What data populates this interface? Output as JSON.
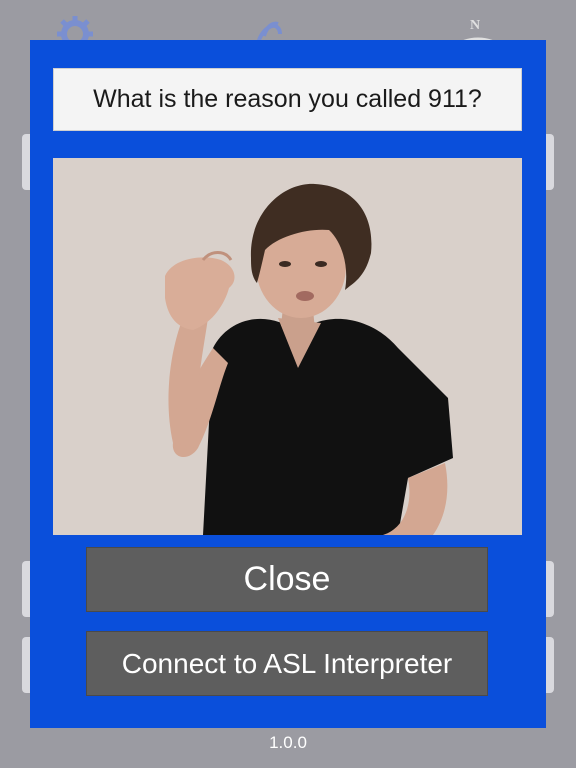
{
  "background": {
    "icons": [
      "gear-icon",
      "hand-icon",
      "compass-icon"
    ],
    "compass_letter": "N",
    "version": "1.0.0"
  },
  "modal": {
    "question": "What is the reason you called 911?",
    "video_icon": "asl-signer-video",
    "close_label": "Close",
    "connect_label": "Connect to ASL Interpreter",
    "colors": {
      "modal_bg": "#0a4fdb",
      "button_bg": "#5e5e5e",
      "question_bg": "#f4f4f4"
    }
  }
}
